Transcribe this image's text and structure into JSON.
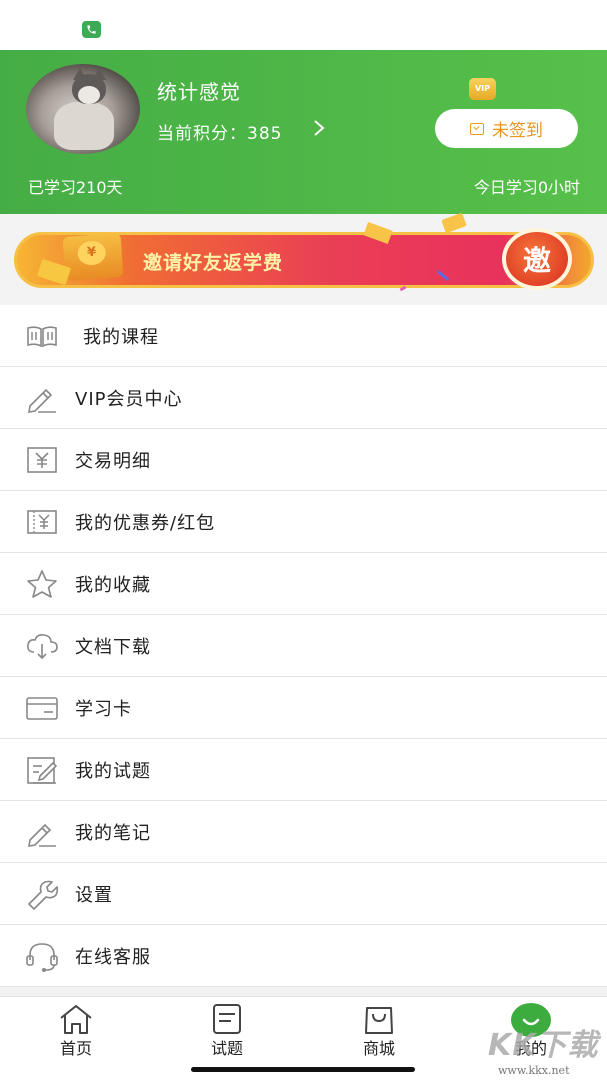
{
  "status_bar": {
    "call_icon": "phone-icon"
  },
  "profile": {
    "user_name": "统计感觉",
    "points_text": "当前积分：385",
    "chevron": "›",
    "vip_badge": "VIP",
    "checkin_label": "未签到",
    "studied_days": "已学习210天",
    "today_study": "今日学习0小时"
  },
  "banner": {
    "text": "邀请好友返学费",
    "invite_char": "邀",
    "coin_symbol": "¥"
  },
  "menu": {
    "items": [
      {
        "label": "我的课程",
        "icon": "book-icon"
      },
      {
        "label": "VIP会员中心",
        "icon": "pen-icon"
      },
      {
        "label": "交易明细",
        "icon": "yuan-receipt-icon"
      },
      {
        "label": "我的优惠券/红包",
        "icon": "coupon-icon"
      },
      {
        "label": "我的收藏",
        "icon": "star-icon"
      },
      {
        "label": "文档下载",
        "icon": "cloud-download-icon"
      },
      {
        "label": "学习卡",
        "icon": "card-icon"
      },
      {
        "label": "我的试题",
        "icon": "exam-icon"
      },
      {
        "label": "我的笔记",
        "icon": "note-pen-icon"
      },
      {
        "label": "设置",
        "icon": "wrench-icon"
      },
      {
        "label": "在线客服",
        "icon": "headset-icon"
      }
    ]
  },
  "bottom_nav": {
    "items": [
      {
        "label": "首页",
        "icon": "home-icon"
      },
      {
        "label": "试题",
        "icon": "document-icon"
      },
      {
        "label": "商城",
        "icon": "shopping-bag-icon"
      },
      {
        "label": "我的",
        "icon": "smile-icon",
        "active": true
      }
    ],
    "active_color": "#3dac3f"
  },
  "watermark": {
    "logo": "KK下载",
    "url": "www.kkx.net"
  },
  "colors": {
    "header_green": "#4db546",
    "accent_orange": "#e8961e",
    "banner_red": "#e8325c"
  }
}
